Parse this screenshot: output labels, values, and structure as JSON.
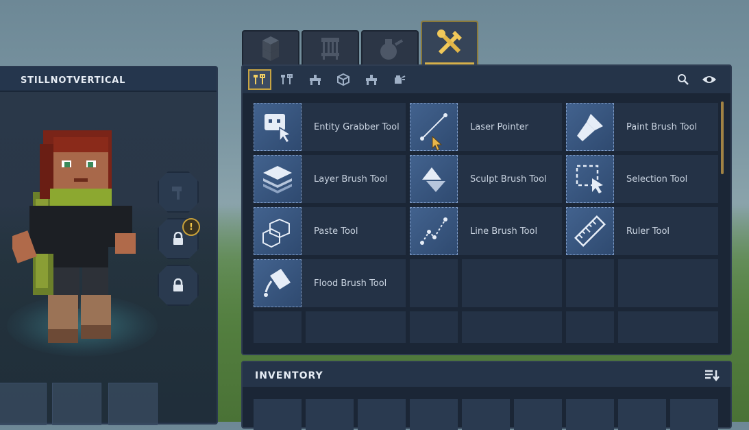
{
  "character": {
    "name": "STILLNOTVERTICAL",
    "notification_badge": "!"
  },
  "top_tabs": [
    {
      "icon": "blocks-icon",
      "active": false
    },
    {
      "icon": "furniture-icon",
      "active": false
    },
    {
      "icon": "potion-icon",
      "active": false
    },
    {
      "icon": "tools-icon",
      "active": true
    }
  ],
  "sub_tabs": [
    {
      "icon": "tools-small-icon",
      "active": true
    },
    {
      "icon": "fork-tools-icon",
      "active": false
    },
    {
      "icon": "workbench-icon",
      "active": false
    },
    {
      "icon": "cube-icon",
      "active": false
    },
    {
      "icon": "anvil-icon",
      "active": false
    },
    {
      "icon": "spray-icon",
      "active": false
    }
  ],
  "tools": [
    {
      "label": "Entity Grabber Tool",
      "icon": "entity-grabber-icon"
    },
    {
      "label": "Laser Pointer",
      "icon": "laser-pointer-icon"
    },
    {
      "label": "Paint Brush Tool",
      "icon": "paint-brush-icon"
    },
    {
      "label": "Layer Brush Tool",
      "icon": "layer-brush-icon"
    },
    {
      "label": "Sculpt Brush Tool",
      "icon": "sculpt-brush-icon"
    },
    {
      "label": "Selection Tool",
      "icon": "selection-icon"
    },
    {
      "label": "Paste Tool",
      "icon": "paste-icon"
    },
    {
      "label": "Line Brush Tool",
      "icon": "line-brush-icon"
    },
    {
      "label": "Ruler Tool",
      "icon": "ruler-icon"
    },
    {
      "label": "Flood Brush Tool",
      "icon": "flood-brush-icon"
    }
  ],
  "inventory": {
    "title": "INVENTORY"
  },
  "colors": {
    "accent": "#d6b04a",
    "panel": "#1b2636",
    "tile": "#42628e"
  }
}
